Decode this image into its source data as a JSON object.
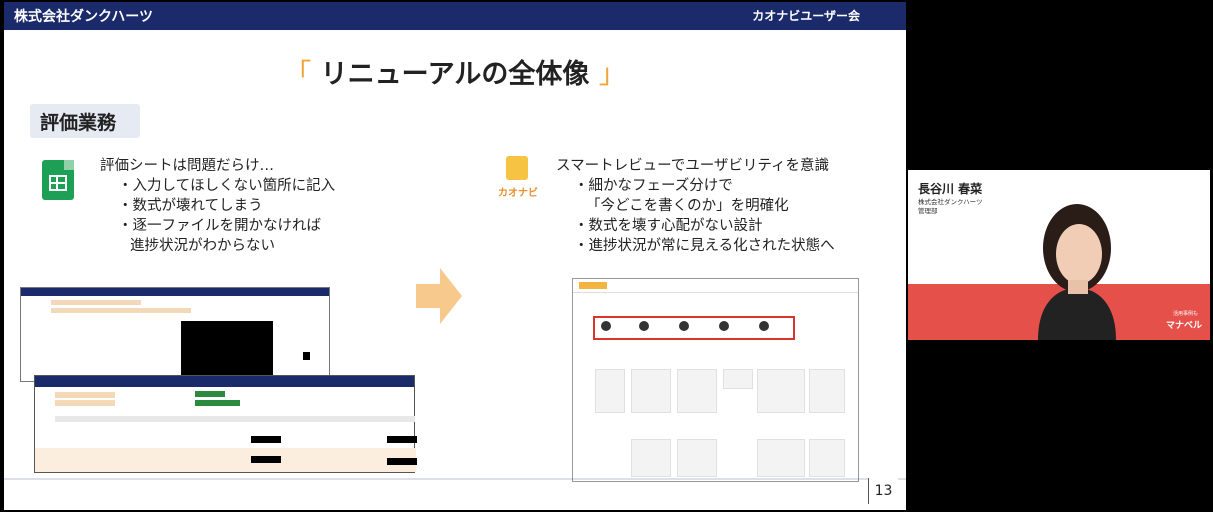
{
  "header": {
    "company": "株式会社ダンクハーツ",
    "event": "カオナビユーザー会"
  },
  "slide": {
    "title_open": "「",
    "title": "リニューアルの全体像",
    "title_close": "」",
    "badge": "評価業務",
    "page_number": "13"
  },
  "left": {
    "heading": "評価シートは問題だらけ…",
    "bullets": [
      "・入力してほしくない箇所に記入",
      "・数式が壊れてしまう",
      "・逐一ファイルを開かなければ",
      "進捗状況がわからない"
    ]
  },
  "right": {
    "icon_label": "カオナビ",
    "heading": "スマートレビューでユーザビリティを意識",
    "bullets": [
      "・細かなフェーズ分けで",
      "「今どこを書くのか」を明確化",
      "・数式を壊す心配がない設計",
      "・進捗状況が常に見える化された状態へ"
    ]
  },
  "speaker": {
    "name": "長谷川 春菜",
    "org_line1": "株式会社ダンクハーツ",
    "org_line2": "管理部",
    "logo_sub": "活用事例も",
    "logo": "マナベル"
  },
  "colors": {
    "navy": "#1b2a6b",
    "accent_orange": "#f0a53a",
    "sheets_green": "#1e9f56",
    "highlight_red": "#d9362b"
  }
}
